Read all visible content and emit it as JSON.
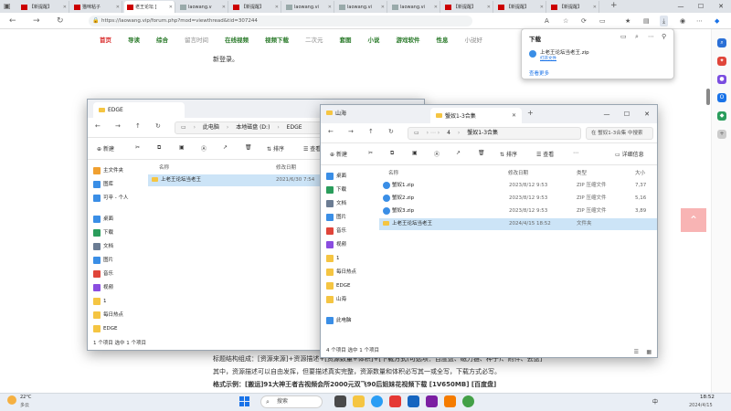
{
  "browser": {
    "tabs": [
      {
        "label": "【新提醒】",
        "active": false,
        "fav": "red"
      },
      {
        "label": "猫咪粘子",
        "active": false,
        "fav": "red"
      },
      {
        "label": "老王论坛 [",
        "active": true,
        "fav": "red"
      },
      {
        "label": "laowang.v",
        "active": false,
        "fav": "gray"
      },
      {
        "label": "【新提醒】",
        "active": false,
        "fav": "red"
      },
      {
        "label": "laowang.vi",
        "active": false,
        "fav": "gray"
      },
      {
        "label": "laowang.vi",
        "active": false,
        "fav": "gray"
      },
      {
        "label": "laowang.vi",
        "active": false,
        "fav": "gray"
      },
      {
        "label": "【新提醒】",
        "active": false,
        "fav": "red"
      },
      {
        "label": "【新提醒】",
        "active": false,
        "fav": "red"
      },
      {
        "label": "【新提醒】",
        "active": false,
        "fav": "red"
      }
    ],
    "url": "https://laowang.vip/forum.php?mod=viewthread&tid=307244",
    "site_nav": [
      "首页",
      "导读",
      "综合",
      "留言时间",
      "在线视频",
      "视频下载",
      "二次元",
      "套图",
      "小说",
      "游戏软件",
      "性息",
      "小説好"
    ],
    "page_text": {
      "login_line": "新登录。",
      "line1": "标题结构组成：[资源来源]+资源描述+[资源数量+体积]+[下载方式(可选项：百度盘、磁力链、种子)、附件、云盘]",
      "line2": "其中，资源描述可以自由发挥，但要描述真实完整，资源数量和体积必写其一或全写，下载方式必写。",
      "line3": "格式示例：[搬运]91大神王者吉视频会所2000元双飞90后姐妹花视频下载 [1V650MB] [百度盘]"
    }
  },
  "download_panel": {
    "title": "下载",
    "file": "上老王论坛当老王.zip",
    "open_link": "打开文件",
    "more": "查看更多"
  },
  "edge_window": {
    "tab": "EDGE",
    "crumbs": [
      "此电脑",
      "本地磁盘 (D:)",
      "EDGE"
    ],
    "cmd": {
      "new": "新建",
      "sort": "排序",
      "view": "查看"
    },
    "nav": [
      {
        "label": "主文件夹",
        "color": "#f0a030"
      },
      {
        "label": "图库",
        "color": "#3a8ee6"
      },
      {
        "label": "可辛 - 个人",
        "color": "#3a8ee6"
      },
      {
        "label": "桌面",
        "color": "#3a8ee6"
      },
      {
        "label": "下载",
        "color": "#2a9d5c"
      },
      {
        "label": "文档",
        "color": "#6b7c93"
      },
      {
        "label": "图片",
        "color": "#3a8ee6"
      },
      {
        "label": "音乐",
        "color": "#e0453a"
      },
      {
        "label": "视频",
        "color": "#8a4de0"
      },
      {
        "label": "1",
        "color": "#f5c542"
      },
      {
        "label": "每日热点",
        "color": "#f5c542"
      },
      {
        "label": "EDGE",
        "color": "#f5c542"
      }
    ],
    "columns": [
      "名称",
      "修改日期"
    ],
    "rows": [
      {
        "name": "上老王论坛当老王",
        "date": "2021/6/30 7:54"
      }
    ],
    "status": "1 个项目    选中 1 个项目"
  },
  "shanhai_window": {
    "tab_back": "山海",
    "tab": "蟹奴1-3合集",
    "crumbs": [
      "4",
      "蟹奴1-3合集"
    ],
    "search": "在 蟹奴1-3合集 中搜索",
    "cmd": {
      "new": "新建",
      "sort": "排序",
      "view": "查看",
      "details": "详细信息"
    },
    "nav": [
      {
        "label": "桌面",
        "color": "#3a8ee6"
      },
      {
        "label": "下载",
        "color": "#2a9d5c"
      },
      {
        "label": "文档",
        "color": "#6b7c93"
      },
      {
        "label": "图片",
        "color": "#3a8ee6"
      },
      {
        "label": "音乐",
        "color": "#e0453a"
      },
      {
        "label": "视频",
        "color": "#8a4de0"
      },
      {
        "label": "1",
        "color": "#f5c542"
      },
      {
        "label": "每日热点",
        "color": "#f5c542"
      },
      {
        "label": "EDGE",
        "color": "#f5c542"
      },
      {
        "label": "山海",
        "color": "#f5c542"
      },
      {
        "label": "此电脑",
        "color": "#3a8ee6"
      }
    ],
    "columns": [
      "名称",
      "修改日期",
      "类型",
      "大小"
    ],
    "rows": [
      {
        "name": "蟹奴1.zip",
        "date": "2023/8/12 9:53",
        "type": "ZIP 压缩文件",
        "size": "7,37"
      },
      {
        "name": "蟹奴2.zip",
        "date": "2023/8/12 9:53",
        "type": "ZIP 压缩文件",
        "size": "5,16"
      },
      {
        "name": "蟹奴3.zip",
        "date": "2023/8/12 9:53",
        "type": "ZIP 压缩文件",
        "size": "3,89"
      },
      {
        "name": "上老王论坛当老王",
        "date": "2024/4/15 18:52",
        "type": "文件夹",
        "size": ""
      }
    ],
    "status": "4 个项目    选中 1 个项目"
  },
  "taskbar": {
    "weather_temp": "22°C",
    "weather_desc": "多云",
    "search": "搜索",
    "time": "18:52",
    "date": "2024/4/15",
    "lang": "中"
  }
}
